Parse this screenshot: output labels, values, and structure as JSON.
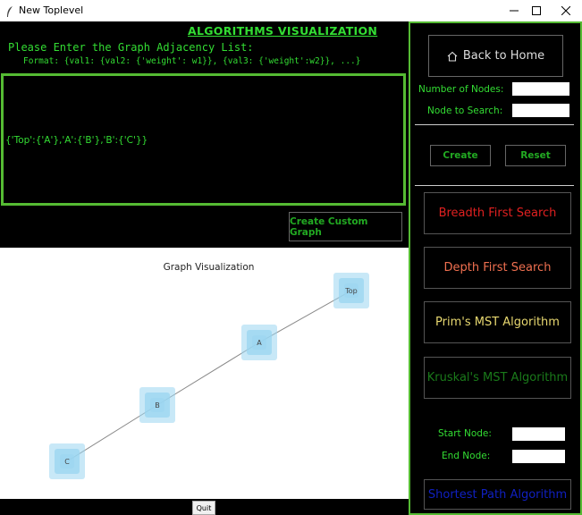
{
  "window": {
    "title": "New Toplevel"
  },
  "header": {
    "title": "ALGORITHMS VISUALIZATION",
    "prompt": "Please Enter the Graph Adjacency List:",
    "format": "Format: {val1: {val2: {'weight': w1}}, {val3: {'weight':w2}}, ...}"
  },
  "adjacency_input": {
    "value": "{'Top':{'A'},'A':{'B'},'B':{'C'}}"
  },
  "buttons": {
    "create_custom_graph": "Create Custom Graph",
    "quit": "Quit",
    "back_home": "Back to Home",
    "create": "Create",
    "reset": "Reset"
  },
  "fields": {
    "num_nodes_label": "Number of Nodes:",
    "num_nodes_value": "",
    "node_search_label": "Node to Search:",
    "node_search_value": "",
    "start_node_label": "Start Node:",
    "start_node_value": "",
    "end_node_label": "End Node:",
    "end_node_value": ""
  },
  "algorithms": {
    "bfs": {
      "label": "Breadth First Search",
      "color": "#e02020"
    },
    "dfs": {
      "label": "Depth First Search",
      "color": "#f07050"
    },
    "prim": {
      "label": "Prim's MST Algorithm",
      "color": "#e8d870"
    },
    "kruskal": {
      "label": "Kruskal's MST Algorithm",
      "color": "#1a7a1a"
    },
    "shortest": {
      "label": "Shortest Path Algorithm",
      "color": "#1020c0"
    }
  },
  "graph": {
    "title": "Graph Visualization",
    "node_color": "#9ad6f0",
    "nodes": [
      {
        "id": "Top",
        "label": "Top"
      },
      {
        "id": "A",
        "label": "A"
      },
      {
        "id": "B",
        "label": "B"
      },
      {
        "id": "C",
        "label": "C"
      }
    ],
    "edges": [
      [
        "Top",
        "A"
      ],
      [
        "A",
        "B"
      ],
      [
        "B",
        "C"
      ]
    ]
  },
  "colors": {
    "accent": "#55bb33",
    "text_green": "#33dd33"
  },
  "icons": {
    "back_home": "home-icon",
    "app": "feather-icon"
  }
}
